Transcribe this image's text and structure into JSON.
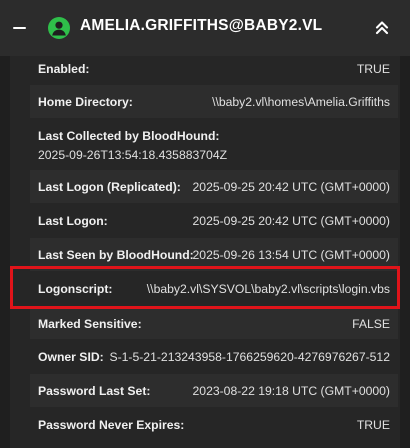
{
  "header": {
    "title": "AMELIA.GRIFFITHS@BABY2.VL",
    "collapse_icon": "minus-icon",
    "user_icon": "user-icon",
    "expand_icon": "chevron-double-up-icon",
    "accent": "#2fbf4a"
  },
  "properties": [
    {
      "label": "Enabled:",
      "value": "TRUE"
    },
    {
      "label": "Home Directory:",
      "value": "\\\\baby2.vl\\homes\\Amelia.Griffiths"
    },
    {
      "label": "Last Collected by BloodHound:",
      "value": "2025-09-26T13:54:18.435883704Z"
    },
    {
      "label": "Last Logon (Replicated):",
      "value": "2025-09-25 20:42 UTC (GMT+0000)"
    },
    {
      "label": "Last Logon:",
      "value": "2025-09-25 20:42 UTC (GMT+0000)"
    },
    {
      "label": "Last Seen by BloodHound:",
      "value": "2025-09-26 13:54 UTC (GMT+0000)"
    },
    {
      "label": "Logonscript:",
      "value": "\\\\baby2.vl\\SYSVOL\\baby2.vl\\scripts\\login.vbs"
    },
    {
      "label": "Marked Sensitive:",
      "value": "FALSE"
    },
    {
      "label": "Owner SID:",
      "value": "S-1-5-21-213243958-1766259620-4276976267-512"
    },
    {
      "label": "Password Last Set:",
      "value": "2023-08-22 19:18 UTC (GMT+0000)"
    },
    {
      "label": "Password Never Expires:",
      "value": "TRUE"
    }
  ],
  "highlight_color": "#e0141a"
}
